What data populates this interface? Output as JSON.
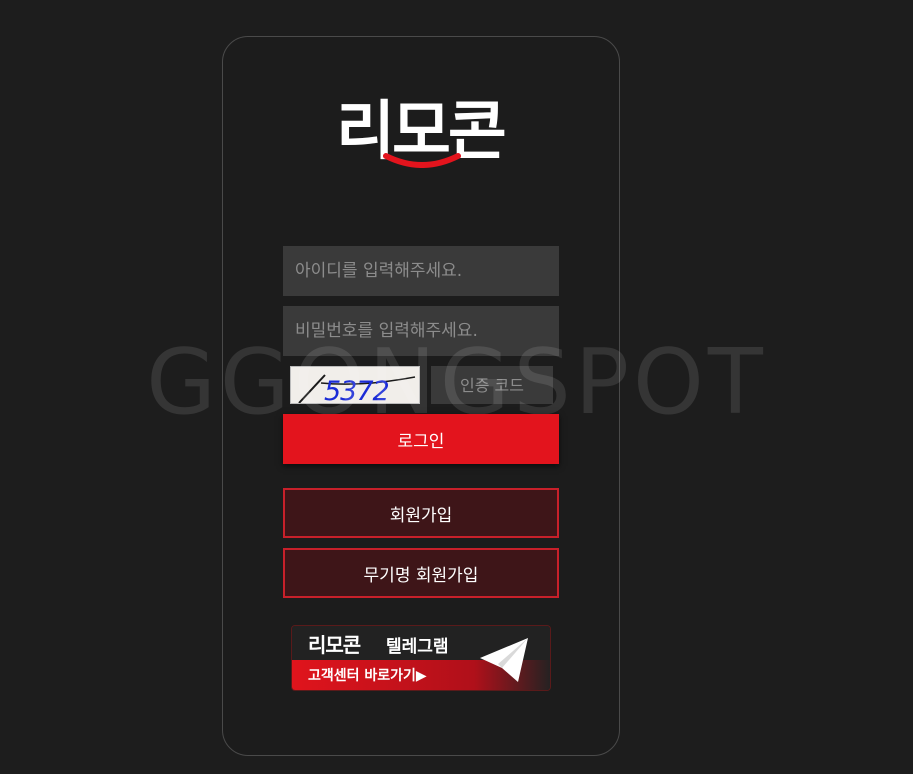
{
  "logo": {
    "text": "리모콘"
  },
  "login_form": {
    "id_placeholder": "아이디를 입력해주세요.",
    "password_placeholder": "비밀번호를 입력해주세요.",
    "captcha_code": "5372",
    "captcha_placeholder": "인증 코드",
    "login_label": "로그인",
    "signup_label": "회원가입",
    "anonymous_signup_label": "무기명 회원가입"
  },
  "watermark": "GGONGSPOT",
  "telegram_banner": {
    "brand": "리모콘",
    "label": "텔레그램",
    "cta": "고객센터 바로가기▶",
    "icon": "paper-plane-icon"
  },
  "colors": {
    "accent": "#e3141d",
    "background": "#1d1d1d",
    "input_bg": "#3a3a3a",
    "captcha_text": "#1a2bd6"
  }
}
